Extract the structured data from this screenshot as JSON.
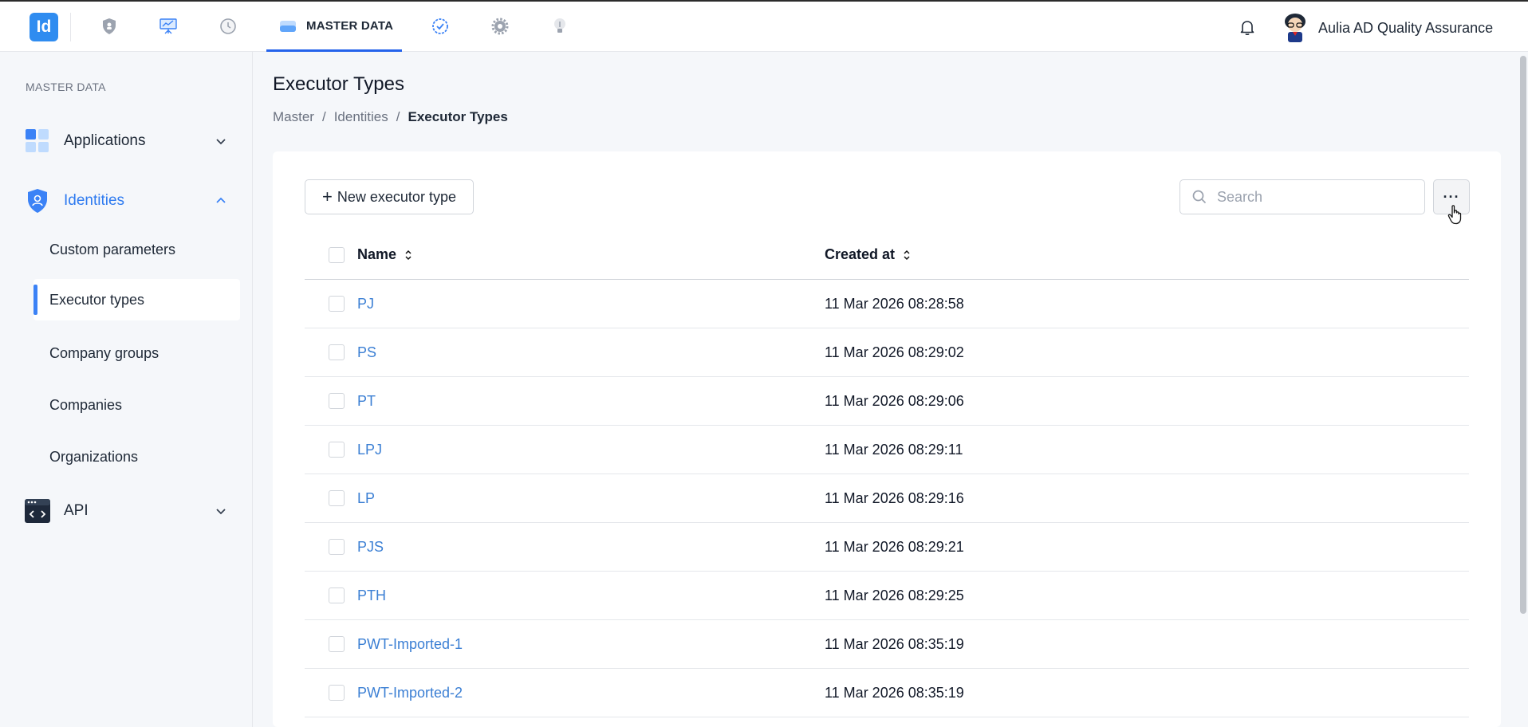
{
  "topbar": {
    "logo_text": "Id",
    "nav_icons": [
      "shield-icon",
      "presentation-icon",
      "clock-icon",
      "database-icon",
      "check-badge-icon",
      "gear-icon",
      "lightbulb-icon"
    ],
    "active_tab_label": "MASTER DATA",
    "user_name": "Aulia AD Quality Assurance"
  },
  "sidebar": {
    "title": "MASTER DATA",
    "groups": [
      {
        "label": "Applications",
        "icon": "grid-icon",
        "expanded": false
      },
      {
        "label": "Identities",
        "icon": "user-shield-icon",
        "expanded": true
      },
      {
        "label": "API",
        "icon": "code-window-icon",
        "expanded": false
      }
    ],
    "sub_items": [
      {
        "label": "Custom parameters",
        "active": false
      },
      {
        "label": "Executor types",
        "active": true
      },
      {
        "label": "Company groups",
        "active": false
      },
      {
        "label": "Companies",
        "active": false
      },
      {
        "label": "Organizations",
        "active": false
      }
    ]
  },
  "page": {
    "title": "Executor Types",
    "breadcrumb": [
      "Master",
      "Identities",
      "Executor Types"
    ]
  },
  "toolbar": {
    "new_label": "New executor type",
    "search_placeholder": "Search",
    "more_label": "···"
  },
  "table": {
    "columns": [
      "Name",
      "Created at"
    ],
    "rows": [
      {
        "name": "PJ",
        "created_at": "11 Mar 2026 08:28:58"
      },
      {
        "name": "PS",
        "created_at": "11 Mar 2026 08:29:02"
      },
      {
        "name": "PT",
        "created_at": "11 Mar 2026 08:29:06"
      },
      {
        "name": "LPJ",
        "created_at": "11 Mar 2026 08:29:11"
      },
      {
        "name": "LP",
        "created_at": "11 Mar 2026 08:29:16"
      },
      {
        "name": "PJS",
        "created_at": "11 Mar 2026 08:29:21"
      },
      {
        "name": "PTH",
        "created_at": "11 Mar 2026 08:29:25"
      },
      {
        "name": "PWT-Imported-1",
        "created_at": "11 Mar 2026 08:35:19"
      },
      {
        "name": "PWT-Imported-2",
        "created_at": "11 Mar 2026 08:35:19"
      }
    ]
  },
  "colors": {
    "accent": "#2563eb",
    "link": "#3b7fd4",
    "background": "#f5f7fa"
  }
}
